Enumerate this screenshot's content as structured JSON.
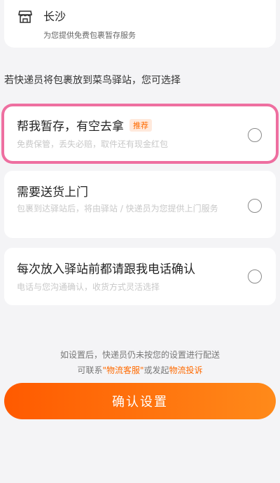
{
  "store": {
    "name": "长沙",
    "description": "为您提供免费包裹暂存服务",
    "icon": "store-icon"
  },
  "section_title": "若快递员将包裹放到菜鸟驿站，您可选择",
  "options": [
    {
      "title": "帮我暂存，有空去拿",
      "badge": "推荐",
      "description": "免费保管，丢失必赔，取件还有现金红包",
      "selected": false
    },
    {
      "title": "需要送货上门",
      "description": "包裹到达驿站后，将由驿站 / 快递员为您提供上门服务",
      "selected": false
    },
    {
      "title": "每次放入驿站前都请跟我电话确认",
      "description": "电话与您沟通确认，收货方式灵活选择",
      "selected": false
    }
  ],
  "footer": {
    "line1": "如设置后，快递员仍未按您的设置进行配送",
    "line2_prefix": "可联系",
    "link1": "\"物流客服\"",
    "line2_middle": "或发起",
    "link2": "物流投诉"
  },
  "confirm_label": "确认设置",
  "colors": {
    "accent": "#ff6a00",
    "highlight_border": "#ee6fa0",
    "background": "#f4f4f6"
  }
}
